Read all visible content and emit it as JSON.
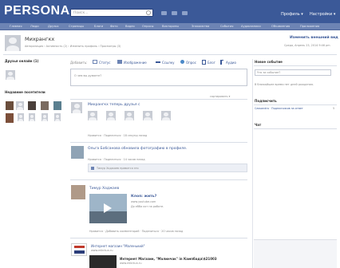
{
  "app": {
    "logo": "PERSONA",
    "search_placeholder": "Поиск...",
    "top_right": [
      "Профиль ▾",
      "Настройки ▾"
    ]
  },
  "nav": [
    "Главная",
    "Люди",
    "Друзья",
    "Страницы",
    "Блоги",
    "Фото",
    "Видео",
    "Опросы",
    "Викторины",
    "Знакомства",
    "События",
    "Аудиозаписи",
    "Объявления",
    "Приложения"
  ],
  "profile": {
    "name": "Михрангкх",
    "links": "Авторизация › Активность (2) › Изменить профиль › Просмотры (3)",
    "edit_link": "Изменить внешний вид",
    "date_info": "Среда, Апрель 23, 2014 9:46 pm"
  },
  "left": {
    "friends_online": "Друзья онлайн (1)",
    "recent_visitors": "Недавние посетители"
  },
  "composer": {
    "label": "Добавить:",
    "options": [
      "Статус",
      "Изображение",
      "Ссылку",
      "Опрос",
      "Блог",
      "Аудио"
    ],
    "placeholder": "О чем вы думаете?",
    "sort": "сортировать ▾"
  },
  "feed": [
    {
      "title": "Михрангкх теперь друзья с",
      "meta": "Нравится · Поделиться · 18 секунд назад"
    },
    {
      "title": "Ольга Бобсанова обновила фотографию в профиле.",
      "meta": "Нравится · Поделиться · 14 часов назад",
      "comment": "Тимур Ходжаев нравится это"
    },
    {
      "title": "Тимур Ходжаев",
      "link_title": "Клоп: жить?",
      "link_url": "www.youtube.com",
      "link_desc": "До ебба кот на работе.",
      "meta": "Нравится · Добавить комментарий · Поделиться · 20 часов назад"
    },
    {
      "title": "Интернет магазин \"Маленький\"",
      "url": "www.mikrkun.ru",
      "logo_text": "ИНТЕРНЕТ МАГАЗИН\nDilexir",
      "link_title": "Интернет Магазин, \"Малинчак\" in Кампбада\\$21003",
      "link_url": "www.mikrkun.ru"
    }
  ],
  "right": {
    "new_event": "Новое событие",
    "event_placeholder": "Что за событие?",
    "event_note": "В ближайшее время нет дней рождения.",
    "subscribe": "Подписчить",
    "subscribe_item": "Cassandra · Подписчиков за ответ",
    "subscribe_count": "5",
    "chat": "Чат"
  }
}
